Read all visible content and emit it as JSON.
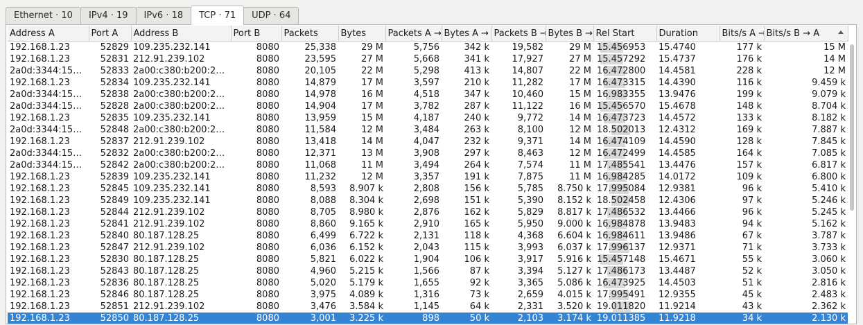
{
  "tabs": [
    {
      "label": "Ethernet · 10",
      "active": false
    },
    {
      "label": "IPv4 · 19",
      "active": false
    },
    {
      "label": "IPv6 · 18",
      "active": false
    },
    {
      "label": "TCP · 71",
      "active": true
    },
    {
      "label": "UDP · 64",
      "active": false
    }
  ],
  "columns": [
    "Address A",
    "Port A",
    "Address B",
    "Port B",
    "Packets",
    "Bytes",
    "Packets A →",
    "Bytes A →",
    "Packets B →",
    "Bytes B →",
    "Rel Start",
    "Duration",
    "Bits/s A →",
    "Bits/s B → A"
  ],
  "sort_column": "Bits/s B → A",
  "rows": [
    [
      "192.168.1.23",
      "52829",
      "109.235.232.141",
      "8080",
      "25,338",
      "29 M",
      "5,756",
      "342 k",
      "19,582",
      "29 M",
      "15.456953",
      "15.4740",
      "177 k",
      "15 M"
    ],
    [
      "192.168.1.23",
      "52831",
      "212.91.239.102",
      "8080",
      "23,595",
      "27 M",
      "5,668",
      "341 k",
      "17,927",
      "27 M",
      "15.457292",
      "15.4737",
      "176 k",
      "14 M"
    ],
    [
      "2a0d:3344:15…",
      "52833",
      "2a00:c380:b200:2…",
      "8080",
      "20,105",
      "22 M",
      "5,298",
      "413 k",
      "14,807",
      "22 M",
      "16.472800",
      "14.4581",
      "228 k",
      "12 M"
    ],
    [
      "192.168.1.23",
      "52834",
      "109.235.232.141",
      "8080",
      "14,879",
      "17 M",
      "3,597",
      "210 k",
      "11,282",
      "17 M",
      "16.473315",
      "14.4390",
      "116 k",
      "9.459 k"
    ],
    [
      "2a0d:3344:15…",
      "52838",
      "2a00:c380:b200:2…",
      "8080",
      "14,978",
      "16 M",
      "4,518",
      "347 k",
      "10,460",
      "15 M",
      "16.983355",
      "13.9476",
      "199 k",
      "9.079 k"
    ],
    [
      "2a0d:3344:15…",
      "52828",
      "2a00:c380:b200:2…",
      "8080",
      "14,904",
      "17 M",
      "3,782",
      "287 k",
      "11,122",
      "16 M",
      "15.456570",
      "15.4678",
      "148 k",
      "8.704 k"
    ],
    [
      "192.168.1.23",
      "52835",
      "109.235.232.141",
      "8080",
      "13,959",
      "15 M",
      "4,187",
      "240 k",
      "9,772",
      "14 M",
      "16.473723",
      "14.4572",
      "133 k",
      "8.182 k"
    ],
    [
      "2a0d:3344:15…",
      "52848",
      "2a00:c380:b200:2…",
      "8080",
      "11,584",
      "12 M",
      "3,484",
      "263 k",
      "8,100",
      "12 M",
      "18.502013",
      "12.4312",
      "169 k",
      "7.887 k"
    ],
    [
      "192.168.1.23",
      "52837",
      "212.91.239.102",
      "8080",
      "13,418",
      "14 M",
      "4,047",
      "232 k",
      "9,371",
      "14 M",
      "16.474109",
      "14.4590",
      "128 k",
      "7.845 k"
    ],
    [
      "2a0d:3344:15…",
      "52832",
      "2a00:c380:b200:2…",
      "8080",
      "12,371",
      "13 M",
      "3,908",
      "297 k",
      "8,463",
      "12 M",
      "16.472499",
      "14.4585",
      "164 k",
      "7.085 k"
    ],
    [
      "2a0d:3344:15…",
      "52842",
      "2a00:c380:b200:2…",
      "8080",
      "11,068",
      "11 M",
      "3,494",
      "264 k",
      "7,574",
      "11 M",
      "17.485541",
      "13.4476",
      "157 k",
      "6.817 k"
    ],
    [
      "192.168.1.23",
      "52839",
      "109.235.232.141",
      "8080",
      "11,232",
      "12 M",
      "3,357",
      "191 k",
      "7,875",
      "11 M",
      "16.984285",
      "14.0172",
      "109 k",
      "6.800 k"
    ],
    [
      "192.168.1.23",
      "52845",
      "109.235.232.141",
      "8080",
      "8,593",
      "8.907 k",
      "2,808",
      "156 k",
      "5,785",
      "8.750 k",
      "17.995084",
      "12.9381",
      "96 k",
      "5.410 k"
    ],
    [
      "192.168.1.23",
      "52849",
      "109.235.232.141",
      "8080",
      "8,088",
      "8.304 k",
      "2,698",
      "151 k",
      "5,390",
      "8.152 k",
      "18.502458",
      "12.4306",
      "97 k",
      "5.246 k"
    ],
    [
      "192.168.1.23",
      "52844",
      "212.91.239.102",
      "8080",
      "8,705",
      "8.980 k",
      "2,876",
      "162 k",
      "5,829",
      "8.817 k",
      "17.486532",
      "13.4466",
      "96 k",
      "5.245 k"
    ],
    [
      "192.168.1.23",
      "52841",
      "212.91.239.102",
      "8080",
      "8,860",
      "9.165 k",
      "2,910",
      "165 k",
      "5,950",
      "9.000 k",
      "16.984878",
      "13.9483",
      "94 k",
      "5.162 k"
    ],
    [
      "192.168.1.23",
      "52840",
      "80.187.128.25",
      "8080",
      "6,499",
      "6.722 k",
      "2,131",
      "118 k",
      "4,368",
      "6.604 k",
      "16.984611",
      "13.9486",
      "67 k",
      "3.787 k"
    ],
    [
      "192.168.1.23",
      "52847",
      "212.91.239.102",
      "8080",
      "6,036",
      "6.152 k",
      "2,043",
      "115 k",
      "3,993",
      "6.037 k",
      "17.996137",
      "12.9371",
      "71 k",
      "3.733 k"
    ],
    [
      "192.168.1.23",
      "52830",
      "80.187.128.25",
      "8080",
      "5,821",
      "6.022 k",
      "1,904",
      "106 k",
      "3,917",
      "5.916 k",
      "15.457148",
      "15.4671",
      "55 k",
      "3.060 k"
    ],
    [
      "192.168.1.23",
      "52843",
      "80.187.128.25",
      "8080",
      "4,960",
      "5.215 k",
      "1,566",
      "87 k",
      "3,394",
      "5.127 k",
      "17.486173",
      "13.4487",
      "52 k",
      "3.050 k"
    ],
    [
      "192.168.1.23",
      "52836",
      "80.187.128.25",
      "8080",
      "5,020",
      "5.179 k",
      "1,655",
      "92 k",
      "3,365",
      "5.086 k",
      "16.473925",
      "14.4503",
      "51 k",
      "2.816 k"
    ],
    [
      "192.168.1.23",
      "52846",
      "80.187.128.25",
      "8080",
      "3,975",
      "4.089 k",
      "1,316",
      "73 k",
      "2,659",
      "4.015 k",
      "17.995491",
      "12.9355",
      "45 k",
      "2.483 k"
    ],
    [
      "192.168.1.23",
      "52851",
      "212.91.239.102",
      "8080",
      "3,476",
      "3.584 k",
      "1,145",
      "64 k",
      "2,331",
      "3.520 k",
      "19.011820",
      "11.9214",
      "43 k",
      "2.362 k"
    ],
    [
      "192.168.1.23",
      "52850",
      "80.187.128.25",
      "8080",
      "3,001",
      "3.225 k",
      "898",
      "50 k",
      "2,103",
      "3.174 k",
      "19.011385",
      "11.9218",
      "34 k",
      "2.130 k"
    ]
  ],
  "selected_row": 23,
  "rel_start_bar": {
    "start_ratio": 0.0,
    "end_ratio": 1.0
  },
  "colors": {
    "selection": "#3584d4",
    "bar": "#d9d9d9",
    "header_bg": "#f3f3f3"
  }
}
